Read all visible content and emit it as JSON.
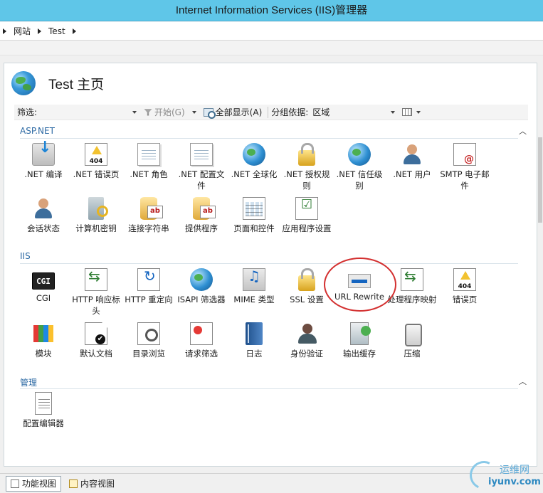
{
  "window": {
    "title": "Internet Information Services (IIS)管理器"
  },
  "breadcrumb": [
    "网站",
    "Test"
  ],
  "header": {
    "title": "Test 主页"
  },
  "filterbar": {
    "filter_label": "筛选:",
    "start_label": "开始(G)",
    "show_all_label": "全部显示(A)",
    "groupby_label": "分组依据:",
    "groupby_value": "区域"
  },
  "sections": [
    {
      "title": "ASP.NET",
      "items": [
        {
          "label": ".NET 编译",
          "icon": "download-icon"
        },
        {
          "label": ".NET 错误页",
          "icon": "error-404-icon"
        },
        {
          "label": ".NET 角色",
          "icon": "roles-icon"
        },
        {
          "label": ".NET 配置文件",
          "icon": "profile-icon"
        },
        {
          "label": ".NET 全球化",
          "icon": "globe-icon"
        },
        {
          "label": ".NET 授权规则",
          "icon": "lock-icon"
        },
        {
          "label": ".NET 信任级别",
          "icon": "trust-icon"
        },
        {
          "label": ".NET 用户",
          "icon": "user-icon"
        },
        {
          "label": "SMTP 电子邮件",
          "icon": "mail-icon"
        },
        {
          "label": "会话状态",
          "icon": "session-icon"
        },
        {
          "label": "计算机密钥",
          "icon": "key-icon"
        },
        {
          "label": "连接字符串",
          "icon": "database-icon"
        },
        {
          "label": "提供程序",
          "icon": "provider-icon"
        },
        {
          "label": "页面和控件",
          "icon": "page-controls-icon"
        },
        {
          "label": "应用程序设置",
          "icon": "settings-icon"
        }
      ]
    },
    {
      "title": "IIS",
      "items": [
        {
          "label": "CGI",
          "icon": "cgi-icon"
        },
        {
          "label": "HTTP 响应标头",
          "icon": "headers-icon"
        },
        {
          "label": "HTTP 重定向",
          "icon": "redirect-icon"
        },
        {
          "label": "ISAPI 筛选器",
          "icon": "isapi-icon"
        },
        {
          "label": "MIME 类型",
          "icon": "mime-icon"
        },
        {
          "label": "SSL 设置",
          "icon": "ssl-lock-icon"
        },
        {
          "label": "URL Rewrite",
          "icon": "rewrite-icon"
        },
        {
          "label": "处理程序映射",
          "icon": "handler-icon"
        },
        {
          "label": "错误页",
          "icon": "error-page-icon"
        },
        {
          "label": "模块",
          "icon": "modules-icon"
        },
        {
          "label": "默认文档",
          "icon": "default-doc-icon"
        },
        {
          "label": "目录浏览",
          "icon": "browse-icon"
        },
        {
          "label": "请求筛选",
          "icon": "request-filter-icon"
        },
        {
          "label": "日志",
          "icon": "log-icon"
        },
        {
          "label": "身份验证",
          "icon": "auth-icon"
        },
        {
          "label": "输出缓存",
          "icon": "cache-icon"
        },
        {
          "label": "压缩",
          "icon": "compress-icon"
        }
      ]
    },
    {
      "title": "管理",
      "items": [
        {
          "label": "配置编辑器",
          "icon": "config-editor-icon"
        }
      ]
    }
  ],
  "bottom_tabs": {
    "features_view": "功能视图",
    "content_view": "内容视图"
  },
  "watermark": {
    "cn": "运维网",
    "en": "iyunv.com"
  },
  "colors": {
    "titlebar": "#5fc6e8",
    "section_heading": "#2d6aa4",
    "annotation": "#d32f2f"
  }
}
